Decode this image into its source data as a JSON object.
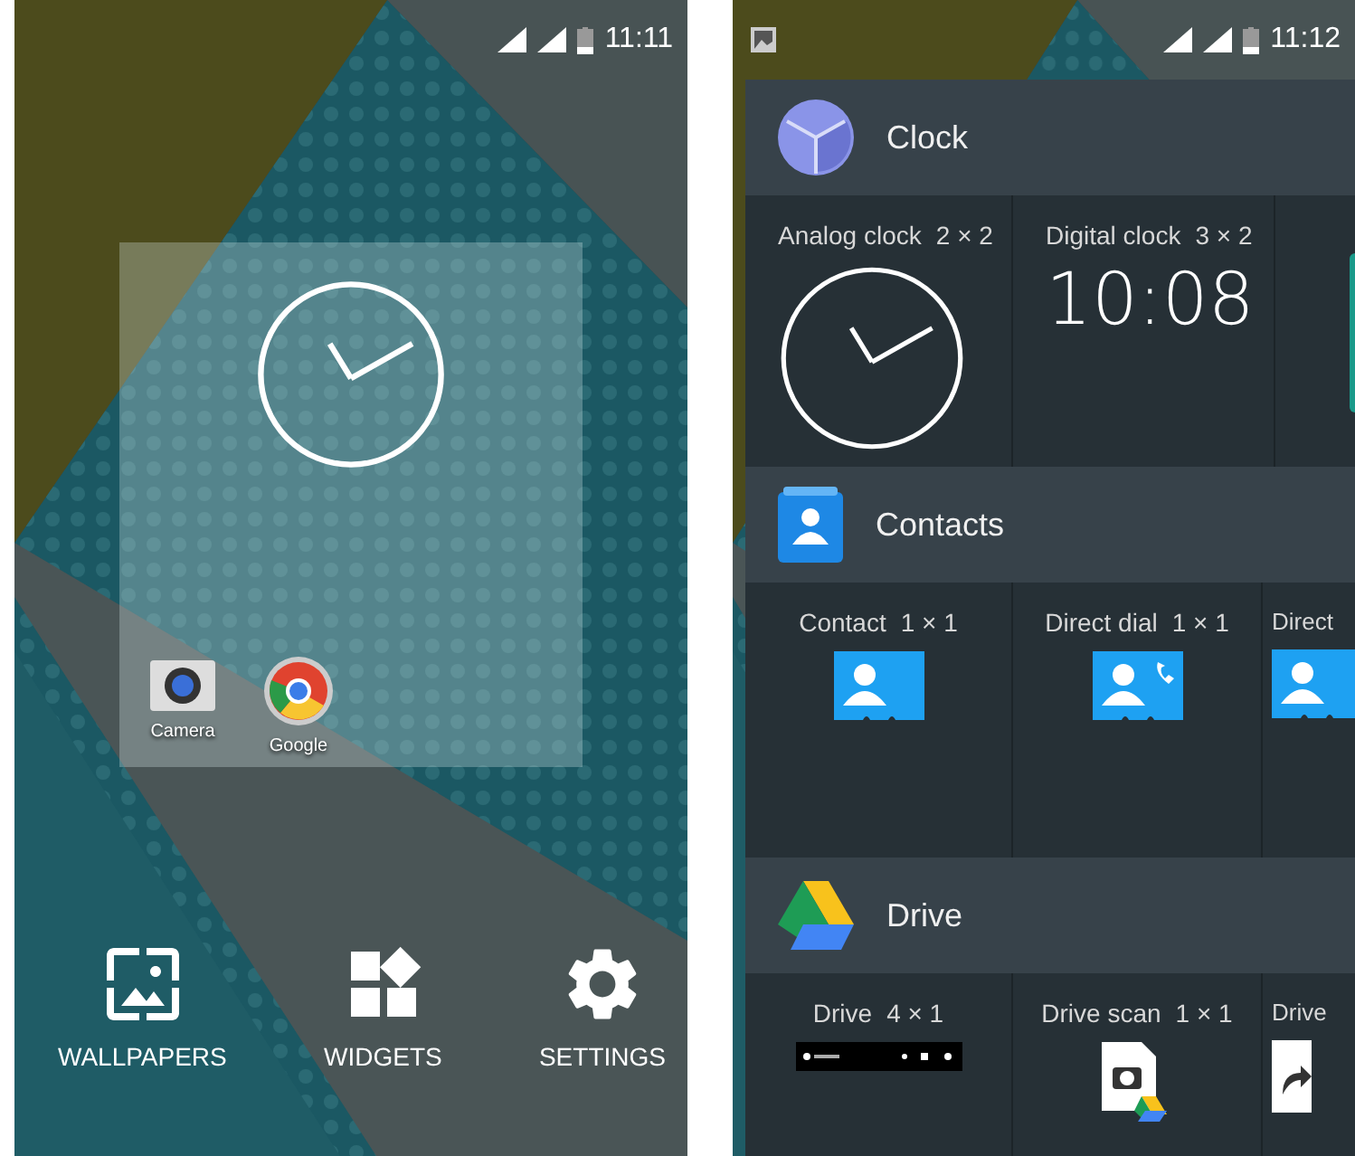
{
  "home_screen": {
    "status_bar": {
      "time": "11:11"
    },
    "apps": [
      {
        "label": "Camera",
        "kind": "camera"
      },
      {
        "label": "Google",
        "kind": "chrome"
      }
    ],
    "actions": [
      {
        "label": "WALLPAPERS",
        "kind": "wallpapers"
      },
      {
        "label": "WIDGETS",
        "kind": "widgets"
      },
      {
        "label": "SETTINGS",
        "kind": "settings"
      }
    ]
  },
  "widget_picker": {
    "status_bar": {
      "time": "11:12"
    },
    "apps": [
      {
        "name": "Clock",
        "kind": "clock",
        "widgets": [
          {
            "label": "Analog clock",
            "size": "2 × 2",
            "kind": "analog"
          },
          {
            "label": "Digital clock",
            "size": "3 × 2",
            "kind": "digital",
            "time": "10:08"
          }
        ]
      },
      {
        "name": "Contacts",
        "kind": "contacts",
        "widgets": [
          {
            "label": "Contact",
            "size": "1 × 1",
            "kind": "contact"
          },
          {
            "label": "Direct dial",
            "size": "1 × 1",
            "kind": "dial"
          },
          {
            "label": "Direct",
            "kind": "contact"
          }
        ]
      },
      {
        "name": "Drive",
        "kind": "drive",
        "widgets": [
          {
            "label": "Drive",
            "size": "4 × 1",
            "kind": "drive-bar"
          },
          {
            "label": "Drive scan",
            "size": "1 × 1",
            "kind": "scan"
          },
          {
            "label": "Drive",
            "kind": "shortcut"
          }
        ]
      }
    ]
  }
}
